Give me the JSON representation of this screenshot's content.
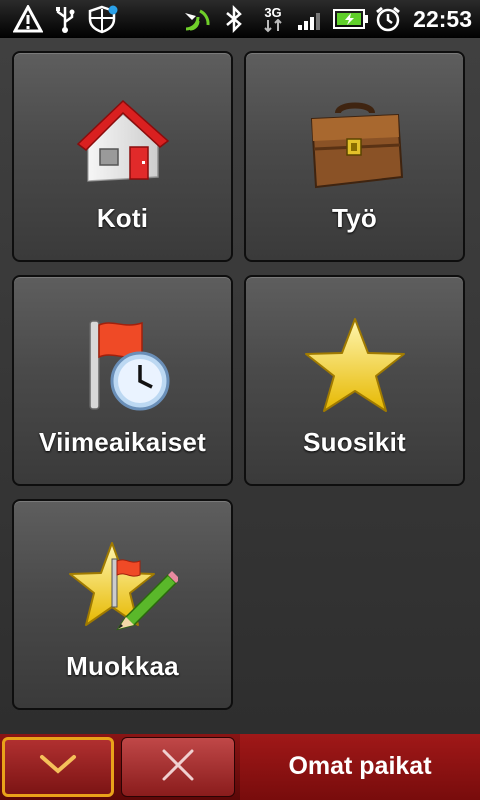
{
  "status_bar": {
    "time": "22:53",
    "network_type": "3G",
    "icons": [
      "warning-icon",
      "usb-icon",
      "shield-icon",
      "gps-icon",
      "bluetooth-icon",
      "network-3g-icon",
      "signal-icon",
      "battery-charging-icon",
      "alarm-icon"
    ]
  },
  "tiles": [
    {
      "label": "Koti",
      "icon": "home-icon"
    },
    {
      "label": "Työ",
      "icon": "briefcase-icon"
    },
    {
      "label": "Viimeaikaiset",
      "icon": "recent-flag-clock-icon"
    },
    {
      "label": "Suosikit",
      "icon": "star-icon"
    },
    {
      "label": "Muokkaa",
      "icon": "edit-star-pencil-icon"
    }
  ],
  "bottom_bar": {
    "title": "Omat paikat",
    "down_icon": "chevron-down-icon",
    "cancel_icon": "close-icon"
  },
  "colors": {
    "accent_border": "#e9a21a",
    "bottom_bar_red": "#8a1414",
    "tile_bg": "#4a4a4a"
  }
}
